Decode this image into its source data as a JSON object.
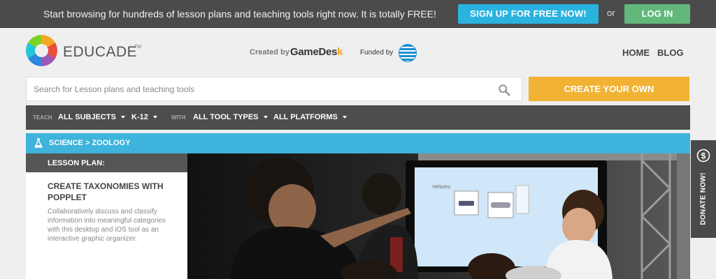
{
  "topbar": {
    "promo": "Start browsing for hundreds of lesson plans and teaching tools right now. It is totally FREE!",
    "signup_label": "SIGN UP FOR FREE NOW!",
    "or_text": "or",
    "login_label": "LOG IN"
  },
  "header": {
    "logo_text": "EDUCADE",
    "logo_tm": "TM",
    "created_by": "Created by",
    "gamedesk_main": "GameDes",
    "gamedesk_k": "k",
    "funded_by": "Funded by",
    "nav": {
      "home": "HOME",
      "blog": "BLOG"
    }
  },
  "search": {
    "placeholder": "Search for Lesson plans and teaching tools",
    "value": "",
    "create_label": "CREATE YOUR OWN"
  },
  "filters": {
    "teach_label": "TEACH",
    "subjects": "ALL SUBJECTS",
    "grade": "K-12",
    "with_label": "WITH",
    "tool_types": "ALL TOOL TYPES",
    "platforms": "ALL PLATFORMS"
  },
  "breadcrumb": "SCIENCE > ZOOLOGY",
  "lesson": {
    "header": "LESSON PLAN:",
    "title": "CREATE TAXONOMIES WITH POPPLET",
    "description": "Collaboratively discuss and classify information into meaningful categories with this desktop and iOS tool as an interactive graphic organizer."
  },
  "photo": {
    "screen_label": "Vehicles"
  },
  "donate": {
    "label": "DONATE NOW!"
  },
  "colors": {
    "topbar": "#4b4b4b",
    "signup": "#2ab3de",
    "login": "#62b87b",
    "create": "#f2b233",
    "filterbar": "#4d4d4d",
    "breadcrumb": "#3eb3dc"
  },
  "icons": [
    "educade-logo-icon",
    "att-logo-icon",
    "search-icon",
    "flask-icon",
    "dollar-icon"
  ]
}
